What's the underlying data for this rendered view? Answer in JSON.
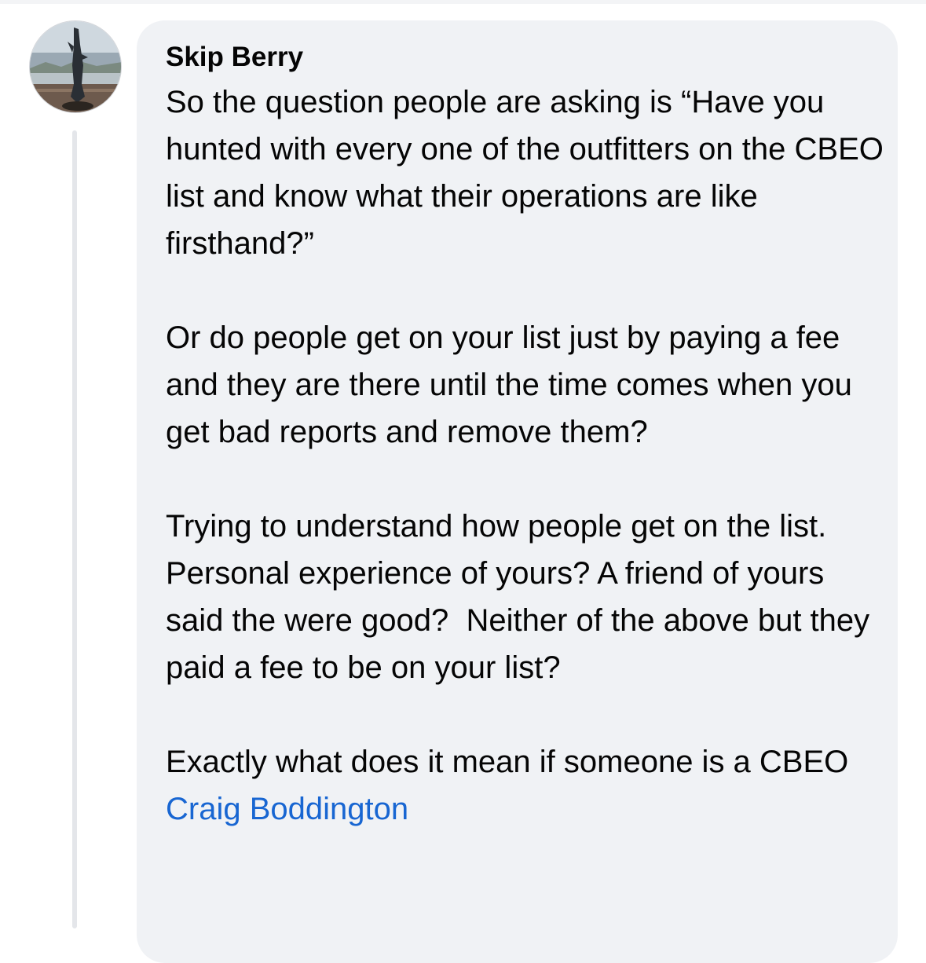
{
  "comment": {
    "author": "Skip Berry",
    "paragraphs": [
      "So the question people are asking is “Have you hunted with every one of the outfitters on the CBEO list and know what their operations are like firsthand?”",
      "Or do people get on your list just by paying a fee and they are there until the time comes when you get bad reports and remove them?",
      "Trying to understand how people get on the list.  Personal experience of yours? A friend of yours said the were good?  Neither of the above but they paid a fee to be on your list?"
    ],
    "last_paragraph_prefix": "Exactly what does it mean if someone is a CBEO ",
    "mention": "Craig Boddington"
  },
  "colors": {
    "bubble_background": "#f0f2f5",
    "text": "#050505",
    "mention_link": "#1866d2",
    "thread_line": "#e4e6ea"
  },
  "icons": {
    "avatar": "profile-photo-avatar"
  }
}
